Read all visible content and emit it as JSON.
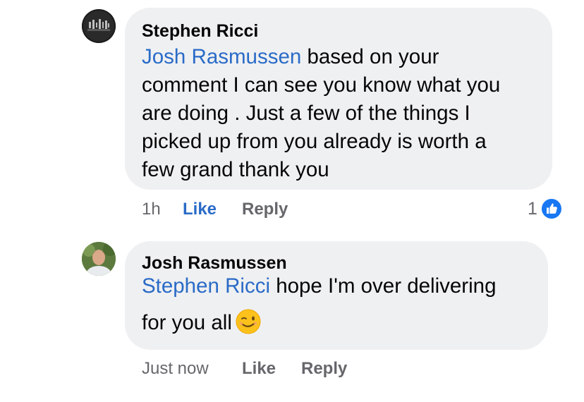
{
  "comments": [
    {
      "author": "Stephen Ricci",
      "mention": "Josh Rasmussen",
      "lines": [
        " based on your",
        "comment I can see you know what you",
        "are doing . Just a few of the things I",
        "picked up from you already is worth a",
        "few grand thank you"
      ],
      "time": "1h",
      "like_label": "Like",
      "reply_label": "Reply",
      "reaction_count": "1",
      "reaction_icon": "thumbs-up-icon"
    },
    {
      "author": "Josh Rasmussen",
      "mention": "Stephen Ricci",
      "lines": [
        " hope I'm over delivering",
        "for you all"
      ],
      "emoji": "winking-face-icon",
      "time": "Just now",
      "like_label": "Like",
      "reply_label": "Reply"
    }
  ],
  "colors": {
    "accent_blue": "#2a6bc7",
    "bubble_bg": "#eff0f2",
    "meta_gray": "#65676b",
    "text": "#050505"
  }
}
